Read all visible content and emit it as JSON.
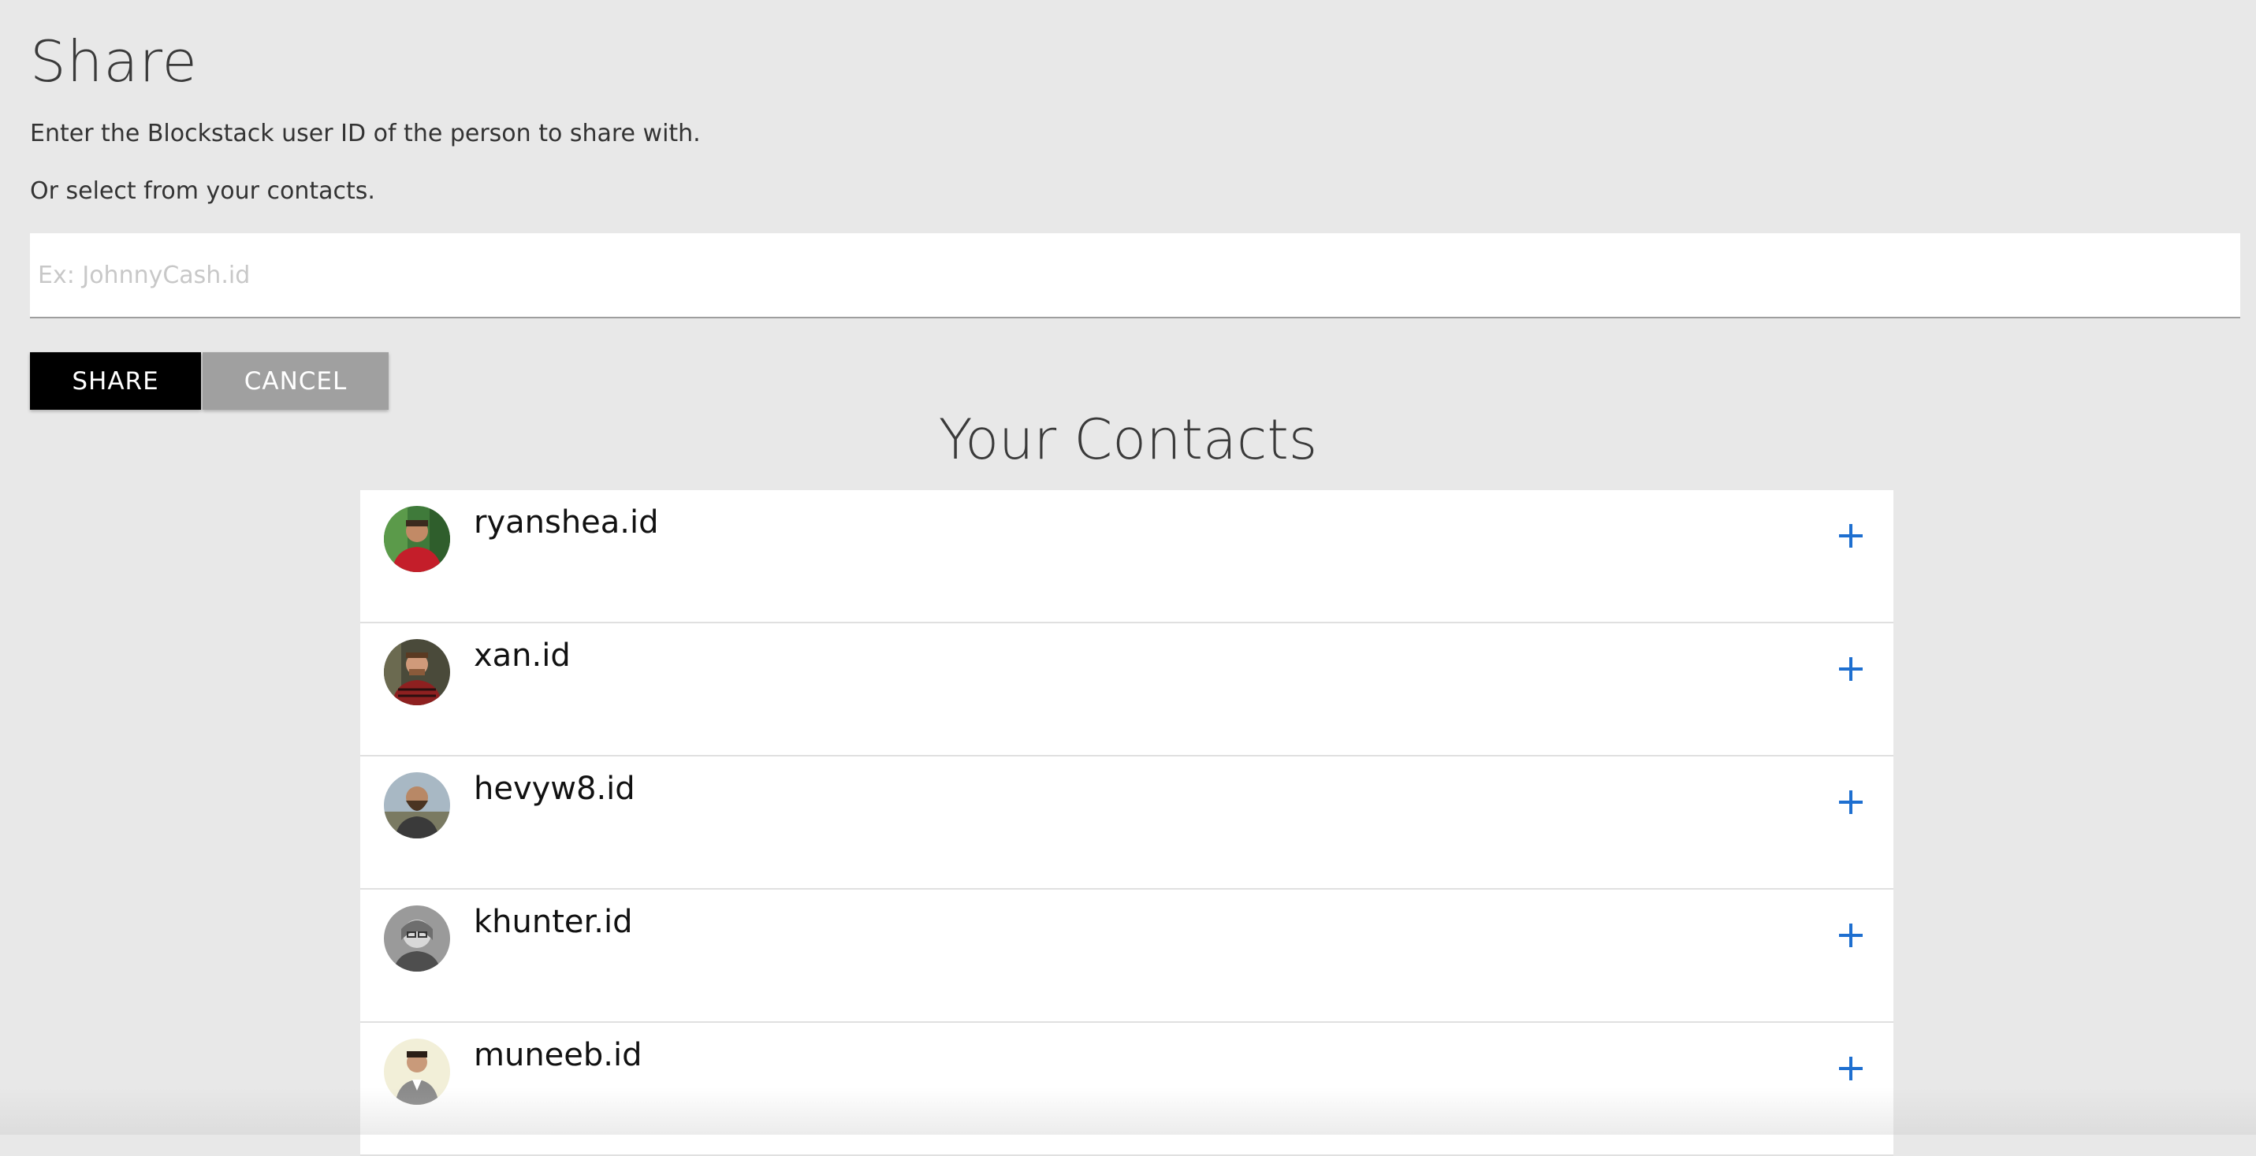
{
  "header": {
    "title": "Share",
    "instruction": "Enter the Blockstack user ID of the person to share with.",
    "contacts_hint": "Or select from your contacts."
  },
  "input": {
    "placeholder": "Ex: JohnnyCash.id",
    "value": ""
  },
  "buttons": {
    "share_label": "SHARE",
    "cancel_label": "CANCEL"
  },
  "contacts": {
    "title": "Your Contacts",
    "items": [
      {
        "name": "ryanshea.id",
        "avatar": "avatar-photo"
      },
      {
        "name": "xan.id",
        "avatar": "avatar-photo"
      },
      {
        "name": "hevyw8.id",
        "avatar": "avatar-photo"
      },
      {
        "name": "khunter.id",
        "avatar": "avatar-photo"
      },
      {
        "name": "muneeb.id",
        "avatar": "avatar-photo"
      }
    ],
    "add_icon": "plus-icon"
  },
  "colors": {
    "background": "#e8e8e8",
    "share_button": "#000000",
    "cancel_button": "#a0a0a0",
    "add_icon": "#1e6fd0"
  }
}
